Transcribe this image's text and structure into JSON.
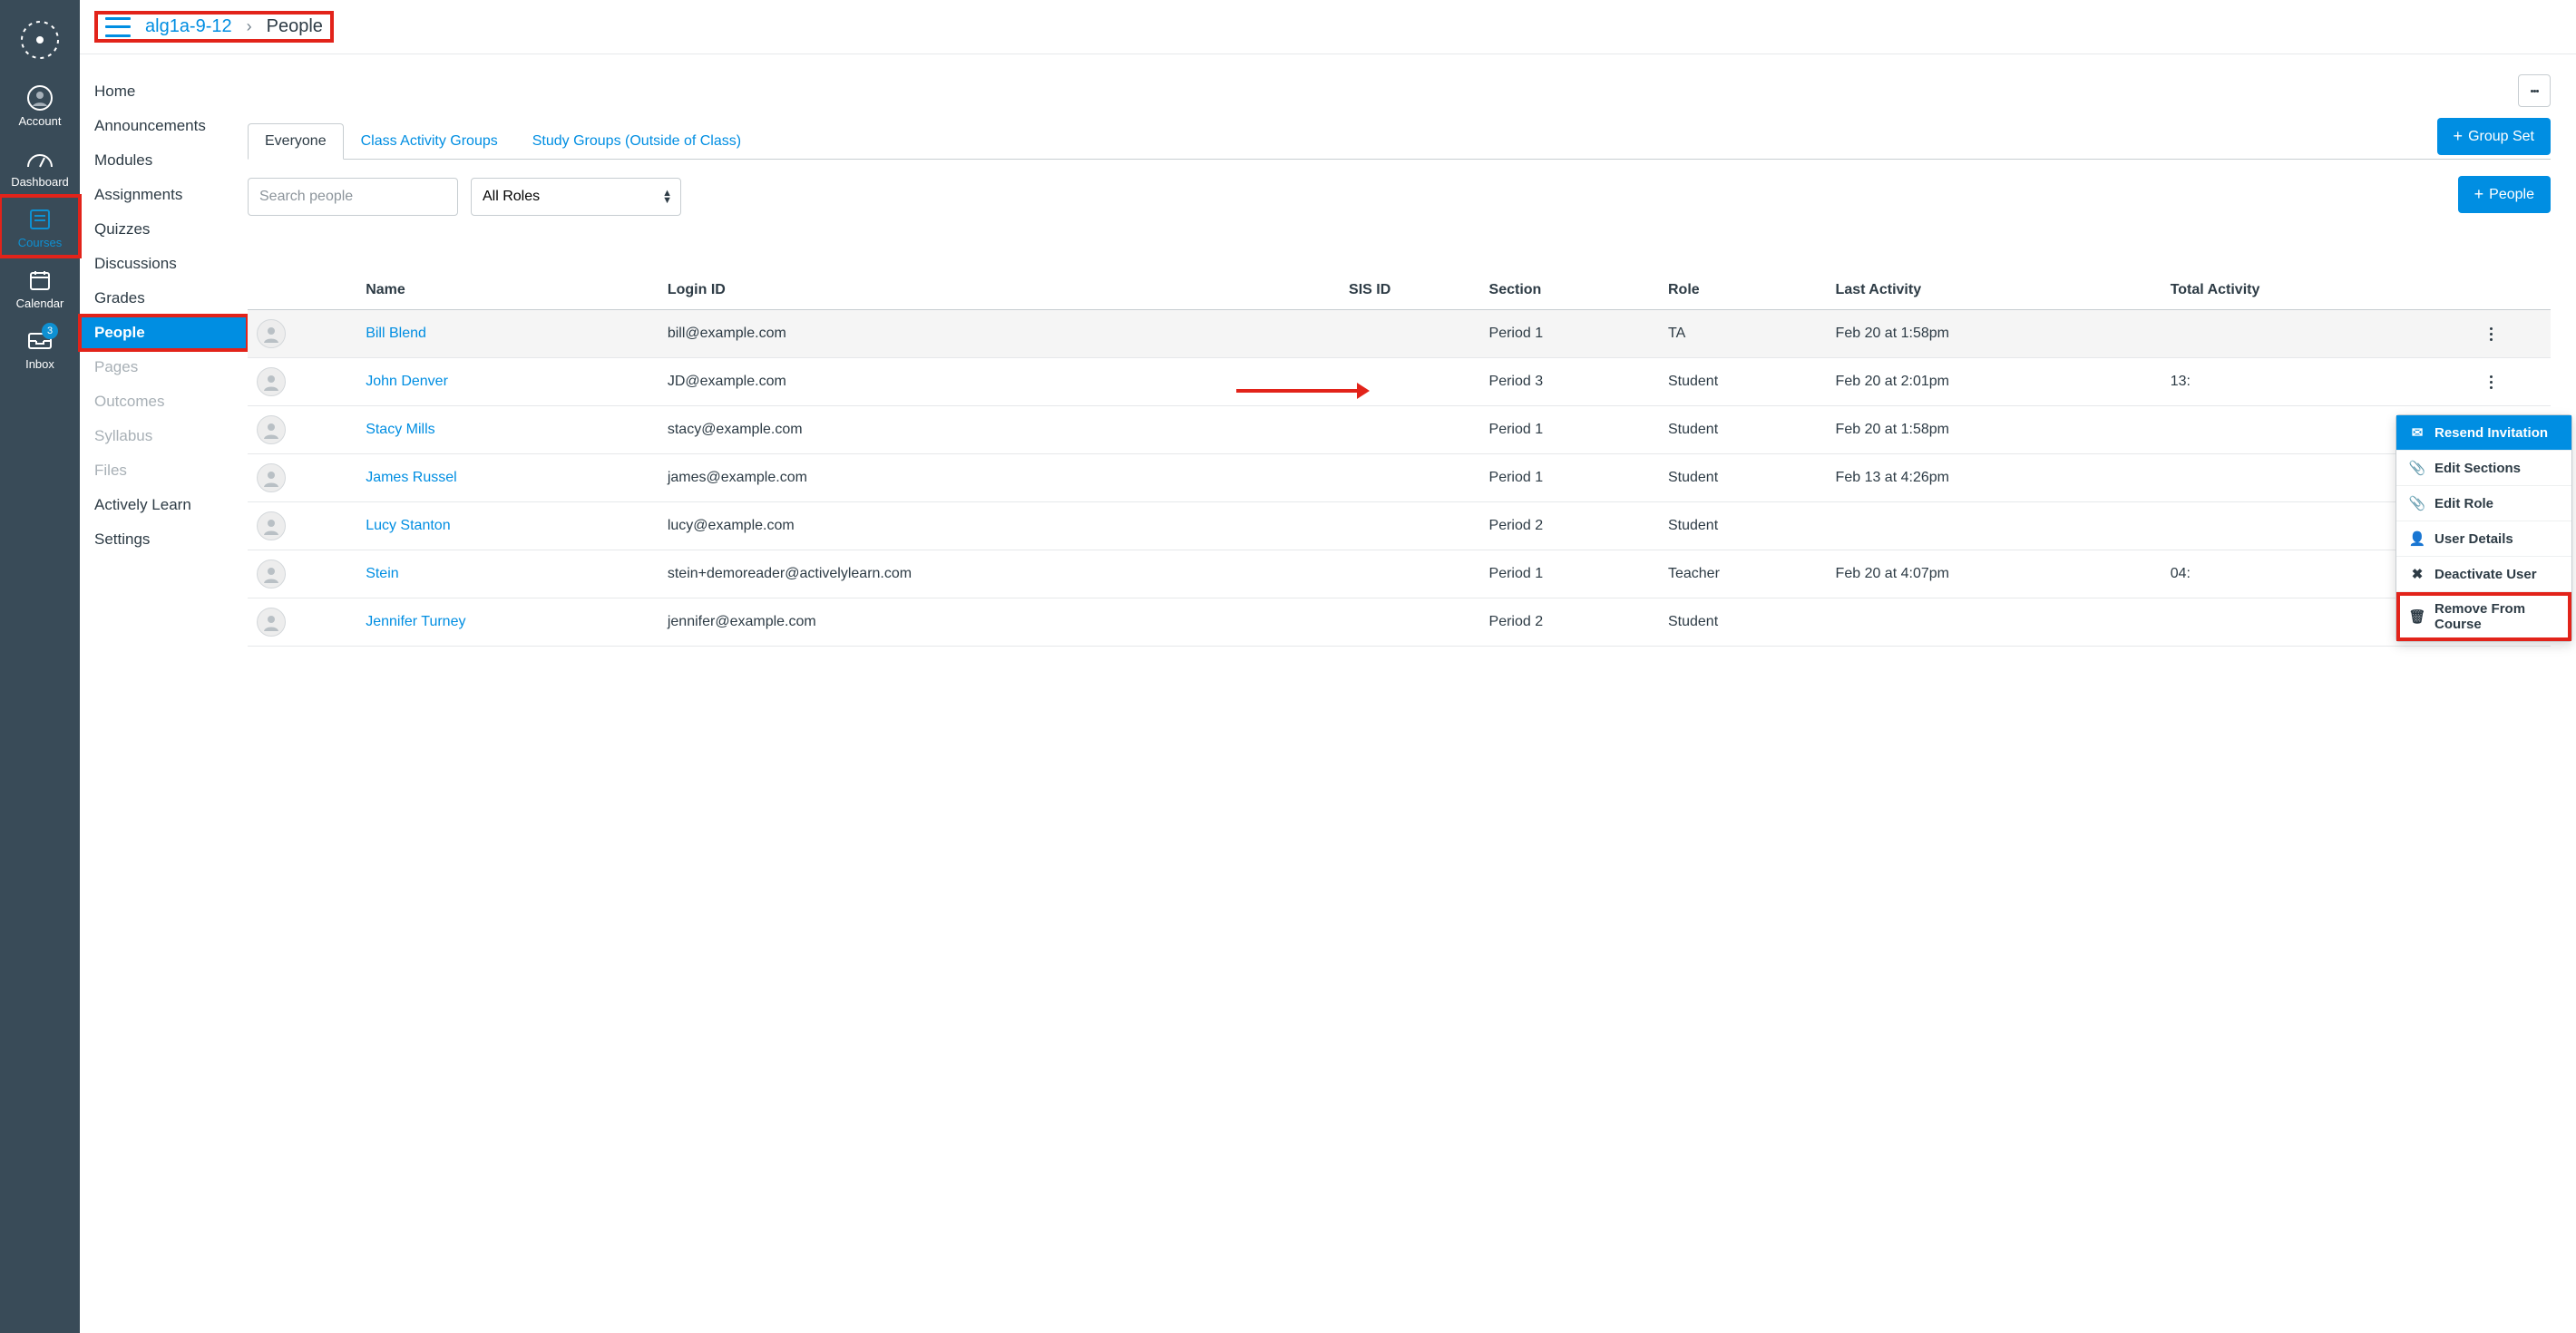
{
  "globalNav": {
    "account": "Account",
    "dashboard": "Dashboard",
    "courses": "Courses",
    "calendar": "Calendar",
    "inbox": "Inbox",
    "inbox_badge": "3"
  },
  "breadcrumb": {
    "course": "alg1a-9-12",
    "page": "People"
  },
  "courseNav": {
    "items": [
      {
        "label": "Home"
      },
      {
        "label": "Announcements"
      },
      {
        "label": "Modules"
      },
      {
        "label": "Assignments"
      },
      {
        "label": "Quizzes"
      },
      {
        "label": "Discussions"
      },
      {
        "label": "Grades"
      },
      {
        "label": "People",
        "active": true
      },
      {
        "label": "Pages",
        "dim": true
      },
      {
        "label": "Outcomes",
        "dim": true
      },
      {
        "label": "Syllabus",
        "dim": true
      },
      {
        "label": "Files",
        "dim": true
      },
      {
        "label": "Actively Learn"
      },
      {
        "label": "Settings"
      }
    ]
  },
  "tabs": {
    "everyone": "Everyone",
    "class_groups": "Class Activity Groups",
    "study_groups": "Study Groups (Outside of Class)"
  },
  "buttons": {
    "group_set": "Group Set",
    "people": "People"
  },
  "filters": {
    "search_placeholder": "Search people",
    "roles_label": "All Roles"
  },
  "table": {
    "headers": {
      "name": "Name",
      "login": "Login ID",
      "sis": "SIS ID",
      "section": "Section",
      "role": "Role",
      "last": "Last Activity",
      "total": "Total Activity"
    },
    "rows": [
      {
        "name": "Bill Blend",
        "login": "bill@example.com",
        "sis": "",
        "section": "Period 1",
        "role": "TA",
        "last": "Feb 20 at 1:58pm",
        "total": "",
        "hover": true
      },
      {
        "name": "John Denver",
        "login": "JD@example.com",
        "sis": "",
        "section": "Period 3",
        "role": "Student",
        "last": "Feb 20 at 2:01pm",
        "total": "13:"
      },
      {
        "name": "Stacy Mills",
        "login": "stacy@example.com",
        "sis": "",
        "section": "Period 1",
        "role": "Student",
        "last": "Feb 20 at 1:58pm",
        "total": ""
      },
      {
        "name": "James Russel",
        "login": "james@example.com",
        "sis": "",
        "section": "Period 1",
        "role": "Student",
        "last": "Feb 13 at 4:26pm",
        "total": ""
      },
      {
        "name": "Lucy Stanton",
        "login": "lucy@example.com",
        "sis": "",
        "section": "Period 2",
        "role": "Student",
        "last": "",
        "total": ""
      },
      {
        "name": "Stein",
        "login": "stein+demoreader@activelylearn.com",
        "sis": "",
        "section": "Period 1",
        "role": "Teacher",
        "last": "Feb 20 at 4:07pm",
        "total": "04:"
      },
      {
        "name": "Jennifer Turney",
        "login": "jennifer@example.com",
        "sis": "",
        "section": "Period 2",
        "role": "Student",
        "last": "",
        "total": ""
      }
    ]
  },
  "dropdown": {
    "resend": "Resend Invitation",
    "edit_sections": "Edit Sections",
    "edit_role": "Edit Role",
    "user_details": "User Details",
    "deactivate": "Deactivate User",
    "remove": "Remove From Course"
  }
}
